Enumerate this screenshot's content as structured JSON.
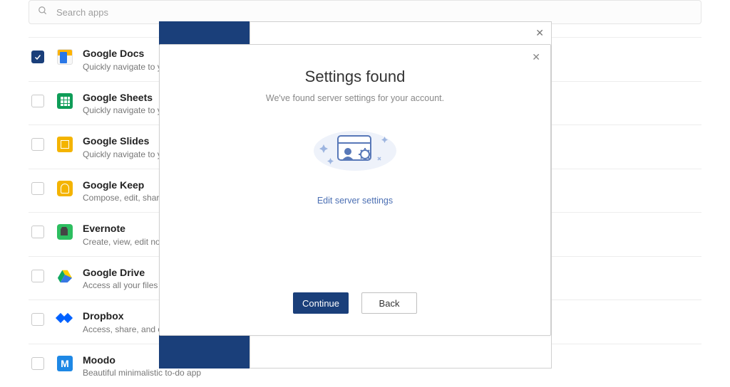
{
  "search": {
    "placeholder": "Search apps"
  },
  "apps": [
    {
      "title": "Google Docs",
      "sub": "Quickly navigate to your recent documents",
      "checked": true,
      "iconClass": "ico-docs",
      "iconName": "google-docs-icon"
    },
    {
      "title": "Google Sheets",
      "sub": "Quickly navigate to your recent spreadsheets",
      "checked": false,
      "iconClass": "ico-sheets",
      "iconName": "google-sheets-icon"
    },
    {
      "title": "Google Slides",
      "sub": "Quickly navigate to your recent presentations",
      "checked": false,
      "iconClass": "ico-slides",
      "iconName": "google-slides-icon"
    },
    {
      "title": "Google Keep",
      "sub": "Compose, edit, share your notes",
      "checked": false,
      "iconClass": "ico-keep",
      "iconName": "google-keep-icon"
    },
    {
      "title": "Evernote",
      "sub": "Create, view, edit notes",
      "checked": false,
      "iconClass": "ico-evernote",
      "iconName": "evernote-icon"
    },
    {
      "title": "Google Drive",
      "sub": "Access all your files in Drive",
      "checked": false,
      "iconClass": "ico-drive",
      "iconName": "google-drive-icon"
    },
    {
      "title": "Dropbox",
      "sub": "Access, share, and organize files",
      "checked": false,
      "iconClass": "ico-dropbox",
      "iconName": "dropbox-icon"
    },
    {
      "title": "Moodo",
      "sub": "Beautiful minimalistic to-do app",
      "checked": false,
      "iconClass": "ico-moodo",
      "iconName": "moodo-icon"
    }
  ],
  "dialog": {
    "title": "Settings found",
    "subtitle": "We've found server settings for your account.",
    "edit_link": "Edit server settings",
    "continue_label": "Continue",
    "back_label": "Back"
  }
}
